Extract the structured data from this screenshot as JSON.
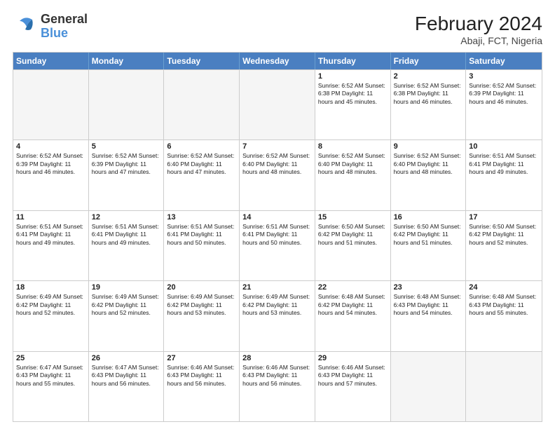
{
  "header": {
    "logo": {
      "line1": "General",
      "line2": "Blue"
    },
    "month_year": "February 2024",
    "location": "Abaji, FCT, Nigeria"
  },
  "days_of_week": [
    "Sunday",
    "Monday",
    "Tuesday",
    "Wednesday",
    "Thursday",
    "Friday",
    "Saturday"
  ],
  "weeks": [
    [
      {
        "day": "",
        "info": "",
        "empty": true
      },
      {
        "day": "",
        "info": "",
        "empty": true
      },
      {
        "day": "",
        "info": "",
        "empty": true
      },
      {
        "day": "",
        "info": "",
        "empty": true
      },
      {
        "day": "1",
        "info": "Sunrise: 6:52 AM\nSunset: 6:38 PM\nDaylight: 11 hours\nand 45 minutes."
      },
      {
        "day": "2",
        "info": "Sunrise: 6:52 AM\nSunset: 6:38 PM\nDaylight: 11 hours\nand 46 minutes."
      },
      {
        "day": "3",
        "info": "Sunrise: 6:52 AM\nSunset: 6:39 PM\nDaylight: 11 hours\nand 46 minutes."
      }
    ],
    [
      {
        "day": "4",
        "info": "Sunrise: 6:52 AM\nSunset: 6:39 PM\nDaylight: 11 hours\nand 46 minutes."
      },
      {
        "day": "5",
        "info": "Sunrise: 6:52 AM\nSunset: 6:39 PM\nDaylight: 11 hours\nand 47 minutes."
      },
      {
        "day": "6",
        "info": "Sunrise: 6:52 AM\nSunset: 6:40 PM\nDaylight: 11 hours\nand 47 minutes."
      },
      {
        "day": "7",
        "info": "Sunrise: 6:52 AM\nSunset: 6:40 PM\nDaylight: 11 hours\nand 48 minutes."
      },
      {
        "day": "8",
        "info": "Sunrise: 6:52 AM\nSunset: 6:40 PM\nDaylight: 11 hours\nand 48 minutes."
      },
      {
        "day": "9",
        "info": "Sunrise: 6:52 AM\nSunset: 6:40 PM\nDaylight: 11 hours\nand 48 minutes."
      },
      {
        "day": "10",
        "info": "Sunrise: 6:51 AM\nSunset: 6:41 PM\nDaylight: 11 hours\nand 49 minutes."
      }
    ],
    [
      {
        "day": "11",
        "info": "Sunrise: 6:51 AM\nSunset: 6:41 PM\nDaylight: 11 hours\nand 49 minutes."
      },
      {
        "day": "12",
        "info": "Sunrise: 6:51 AM\nSunset: 6:41 PM\nDaylight: 11 hours\nand 49 minutes."
      },
      {
        "day": "13",
        "info": "Sunrise: 6:51 AM\nSunset: 6:41 PM\nDaylight: 11 hours\nand 50 minutes."
      },
      {
        "day": "14",
        "info": "Sunrise: 6:51 AM\nSunset: 6:41 PM\nDaylight: 11 hours\nand 50 minutes."
      },
      {
        "day": "15",
        "info": "Sunrise: 6:50 AM\nSunset: 6:42 PM\nDaylight: 11 hours\nand 51 minutes."
      },
      {
        "day": "16",
        "info": "Sunrise: 6:50 AM\nSunset: 6:42 PM\nDaylight: 11 hours\nand 51 minutes."
      },
      {
        "day": "17",
        "info": "Sunrise: 6:50 AM\nSunset: 6:42 PM\nDaylight: 11 hours\nand 52 minutes."
      }
    ],
    [
      {
        "day": "18",
        "info": "Sunrise: 6:49 AM\nSunset: 6:42 PM\nDaylight: 11 hours\nand 52 minutes."
      },
      {
        "day": "19",
        "info": "Sunrise: 6:49 AM\nSunset: 6:42 PM\nDaylight: 11 hours\nand 52 minutes."
      },
      {
        "day": "20",
        "info": "Sunrise: 6:49 AM\nSunset: 6:42 PM\nDaylight: 11 hours\nand 53 minutes."
      },
      {
        "day": "21",
        "info": "Sunrise: 6:49 AM\nSunset: 6:42 PM\nDaylight: 11 hours\nand 53 minutes."
      },
      {
        "day": "22",
        "info": "Sunrise: 6:48 AM\nSunset: 6:42 PM\nDaylight: 11 hours\nand 54 minutes."
      },
      {
        "day": "23",
        "info": "Sunrise: 6:48 AM\nSunset: 6:43 PM\nDaylight: 11 hours\nand 54 minutes."
      },
      {
        "day": "24",
        "info": "Sunrise: 6:48 AM\nSunset: 6:43 PM\nDaylight: 11 hours\nand 55 minutes."
      }
    ],
    [
      {
        "day": "25",
        "info": "Sunrise: 6:47 AM\nSunset: 6:43 PM\nDaylight: 11 hours\nand 55 minutes."
      },
      {
        "day": "26",
        "info": "Sunrise: 6:47 AM\nSunset: 6:43 PM\nDaylight: 11 hours\nand 56 minutes."
      },
      {
        "day": "27",
        "info": "Sunrise: 6:46 AM\nSunset: 6:43 PM\nDaylight: 11 hours\nand 56 minutes."
      },
      {
        "day": "28",
        "info": "Sunrise: 6:46 AM\nSunset: 6:43 PM\nDaylight: 11 hours\nand 56 minutes."
      },
      {
        "day": "29",
        "info": "Sunrise: 6:46 AM\nSunset: 6:43 PM\nDaylight: 11 hours\nand 57 minutes."
      },
      {
        "day": "",
        "info": "",
        "empty": true
      },
      {
        "day": "",
        "info": "",
        "empty": true
      }
    ]
  ]
}
